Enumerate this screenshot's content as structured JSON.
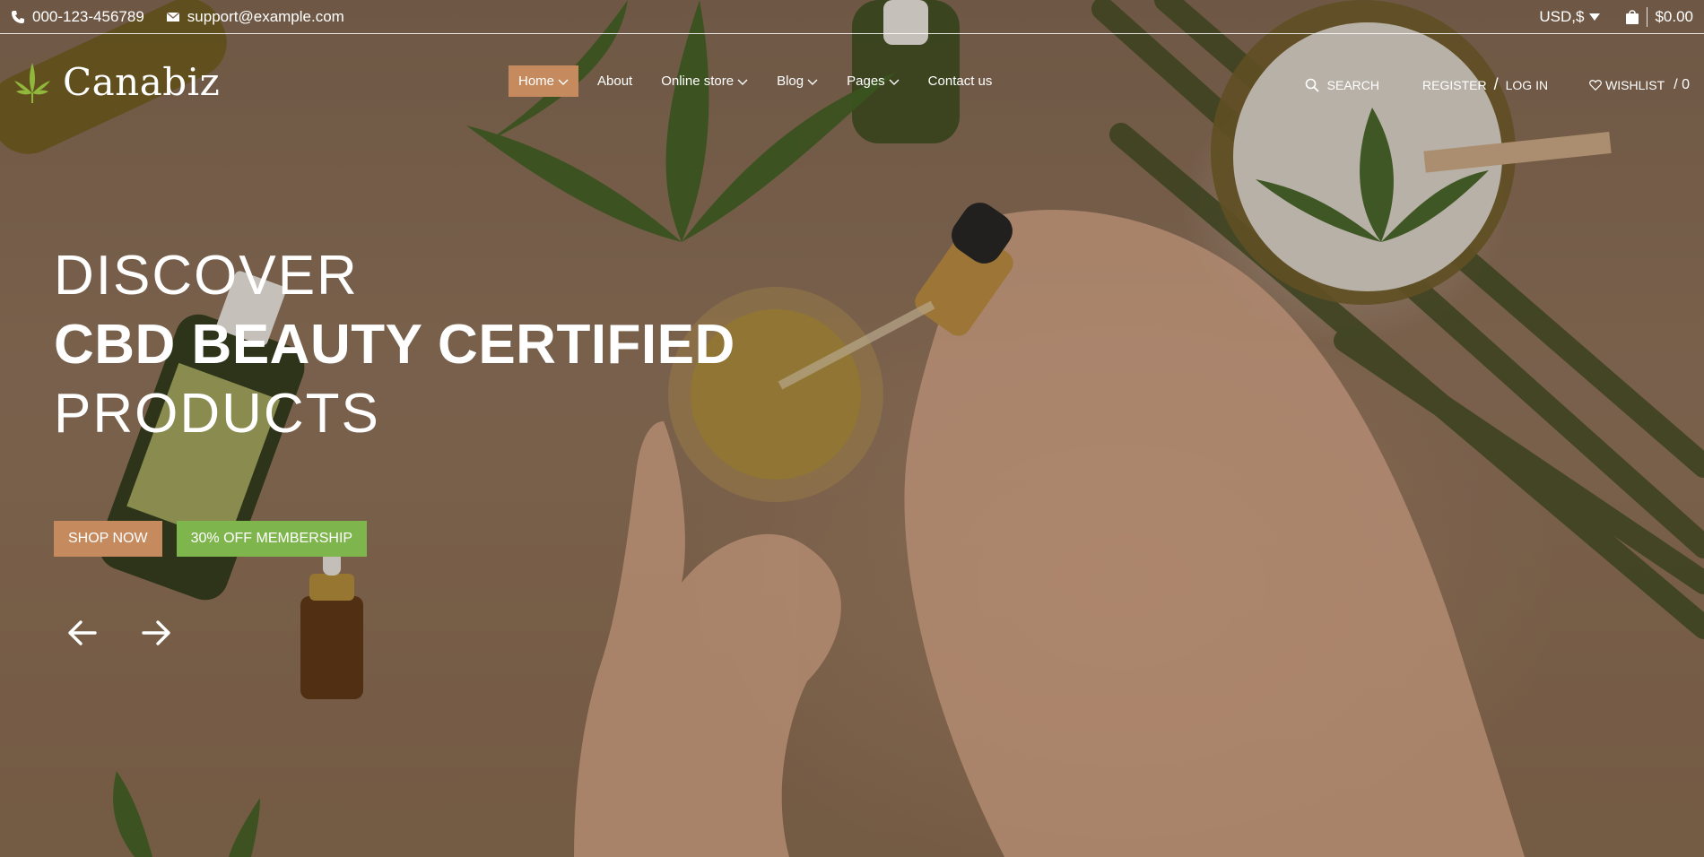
{
  "topbar": {
    "phone": "000-123-456789",
    "email": "support@example.com",
    "currency": "USD,$",
    "cart_total": "$0.00"
  },
  "header": {
    "brand": "Canabiz",
    "nav": [
      {
        "label": "Home",
        "dropdown": true,
        "active": true
      },
      {
        "label": "About",
        "dropdown": false
      },
      {
        "label": "Online store",
        "dropdown": true
      },
      {
        "label": "Blog",
        "dropdown": true
      },
      {
        "label": "Pages",
        "dropdown": true
      },
      {
        "label": "Contact us",
        "dropdown": false
      }
    ],
    "search_label": "SEARCH",
    "register_label": "REGISTER",
    "separator": "/",
    "login_label": "LOG IN",
    "wishlist_label": "WISHLIST",
    "wishlist_count": "/ 0"
  },
  "hero": {
    "line1": "DISCOVER",
    "line2": "CBD BEAUTY CERTIFIED",
    "line3": "PRODUCTS",
    "shop_now": "SHOP NOW",
    "membership": "30% OFF MEMBERSHIP"
  },
  "colors": {
    "accent": "#c58a5d",
    "green": "#7fb54d",
    "text": "#ffffff"
  },
  "icons": [
    "phone-icon",
    "mail-icon",
    "caret-down-icon",
    "bag-icon",
    "leaf-logo-icon",
    "chevron-down-icon",
    "search-icon",
    "heart-icon",
    "arrow-left-icon",
    "arrow-right-icon"
  ]
}
